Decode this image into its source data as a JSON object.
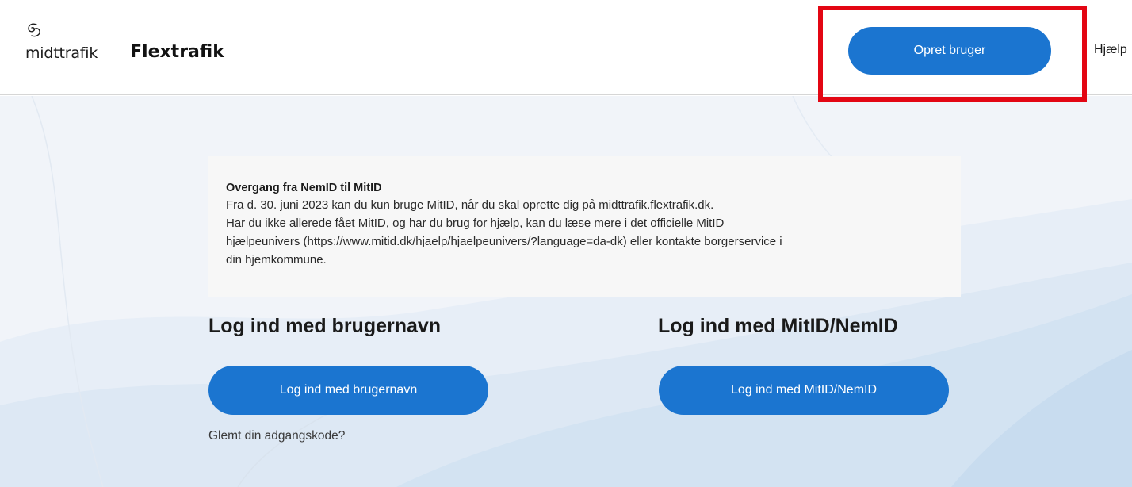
{
  "header": {
    "logo_text": "midttrafik",
    "app_title": "Flextrafik",
    "create_user_label": "Opret bruger",
    "help_label": "Hjælp"
  },
  "notice": {
    "title": "Overgang fra NemID til MitID",
    "lines": [
      "Fra d. 30. juni 2023 kan du kun bruge MitID, når du skal oprette dig på midttrafik.flextrafik.dk.",
      "Har du ikke allerede fået MitID, og har du brug for hjælp, kan du læse mere i det officielle MitID",
      "hjælpeunivers (https://www.mitid.dk/hjaelp/hjaelpeunivers/?language=da-dk) eller kontakte borgerservice i",
      "din hjemkommune."
    ]
  },
  "login_username": {
    "heading": "Log ind med brugernavn",
    "button_label": "Log ind med brugernavn",
    "forgot_label": "Glemt din adgangskode?"
  },
  "login_mitid": {
    "heading": "Log ind med MitID/NemID",
    "button_label": "Log ind med MitID/NemID"
  },
  "colors": {
    "primary": "#1b75d0",
    "highlight": "#e30613",
    "background": "#f1f4f9",
    "notice_bg": "#f7f7f7"
  },
  "icons": {
    "logo_mark": "midttrafik-swirl-icon"
  }
}
